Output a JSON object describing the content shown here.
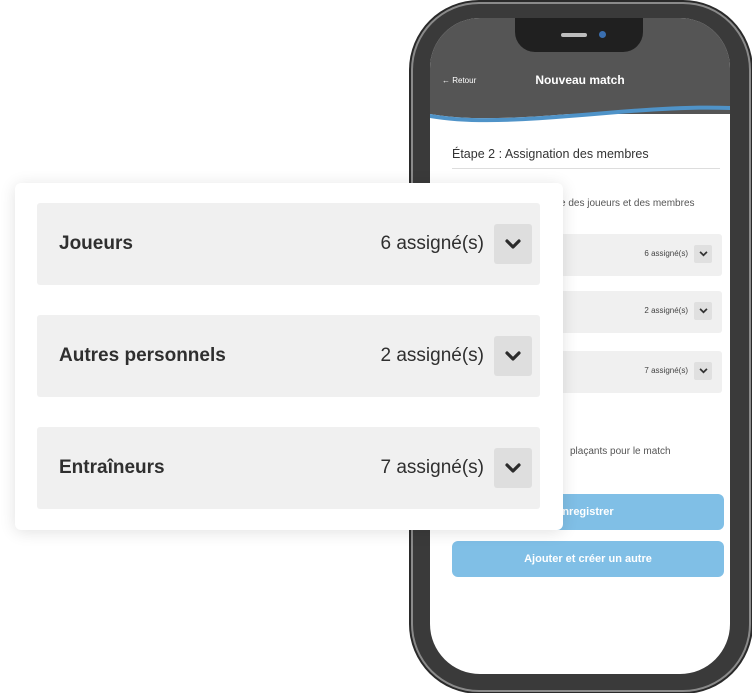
{
  "app": {
    "back_label": "← Retour",
    "title": "Nouveau match"
  },
  "form": {
    "step_title": "Étape 2 : Assignation des membres",
    "description_fragment": "e des joueurs et des membres",
    "replacements_fragment": "plaçants pour le match",
    "save_button_fragment": "nregistrer",
    "add_another_button": "Ajouter et créer un autre"
  },
  "members": [
    {
      "label": "Joueurs",
      "count": "6 assigné(s)"
    },
    {
      "label": "Autres personnels",
      "count": "2 assigné(s)"
    },
    {
      "label": "Entraîneurs",
      "count": "7 assigné(s)"
    }
  ],
  "icons": {
    "toggle": "chevron-down-icon"
  },
  "colors": {
    "header_bg": "#555555",
    "header_wave": "#4f93c8",
    "button_bg": "#80bfe6",
    "row_bg": "#f0f0f0",
    "toggle_bg": "#dedede"
  }
}
